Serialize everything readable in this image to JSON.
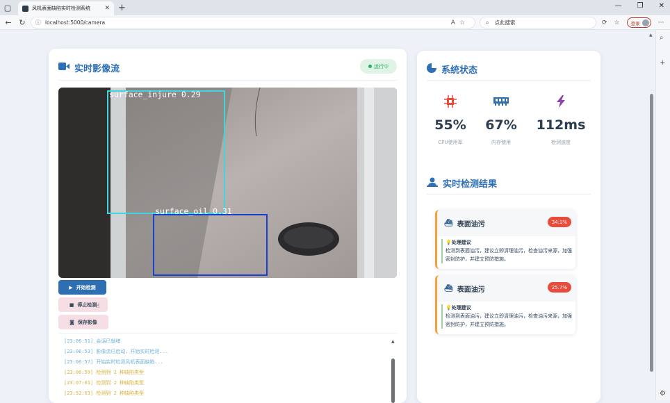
{
  "browser": {
    "tab_title": "风机表面缺陷实时检测系统",
    "url": "localhost:5000/camera",
    "search_placeholder": "点此搜索",
    "login_label": "登录"
  },
  "video_panel": {
    "title": "实时影像流",
    "status": "运行中",
    "detections": [
      {
        "label": "surface_injure 0.29",
        "color": "#3fd6e0"
      },
      {
        "label": "surface_oil 0.31",
        "color": "#1c3fcf"
      }
    ],
    "buttons": {
      "start": "开始检测",
      "stop": "停止检测",
      "save": "保存影像"
    },
    "log": [
      {
        "text": "[23:06:51] 会话已就绪",
        "color": "#6fb1d6"
      },
      {
        "text": "[23:06:53] 影像流已启动，开始实时检测...",
        "color": "#6fb1d6"
      },
      {
        "text": "[23:06:57] 开始实时检测风机表面缺陷...",
        "color": "#6fb1d6"
      },
      {
        "text": "[23:06:59] 检测到 2 种缺陷类型",
        "color": "#d8b13a"
      },
      {
        "text": "[23:07:01] 检测到 2 种缺陷类型",
        "color": "#d8b13a"
      },
      {
        "text": "[23:52:03] 检测到 2 种缺陷类型",
        "color": "#d8b13a"
      }
    ]
  },
  "system_panel": {
    "title": "系统状态",
    "metrics": [
      {
        "icon": "cpu-icon",
        "value": "55%",
        "label": "CPU使用率",
        "color": "#e74c3c"
      },
      {
        "icon": "memory-icon",
        "value": "67%",
        "label": "内存使用",
        "color": "#2d6fb0"
      },
      {
        "icon": "bolt-icon",
        "value": "112ms",
        "label": "检测速度",
        "color": "#8e44ad"
      }
    ]
  },
  "results_panel": {
    "title": "实时检测结果",
    "results": [
      {
        "name": "表面油污",
        "confidence": "34.1%",
        "suggest_title": "处理建议",
        "suggest_text": "检测到表面油污，建议立即清理油污，检查油污来源，加强密封防护，并建立预防措施。"
      },
      {
        "name": "表面油污",
        "confidence": "25.7%",
        "suggest_title": "处理建议",
        "suggest_text": "检测到表面油污，建议立即清理油污，检查油污来源，加强密封防护，并建立预防措施。"
      }
    ]
  }
}
